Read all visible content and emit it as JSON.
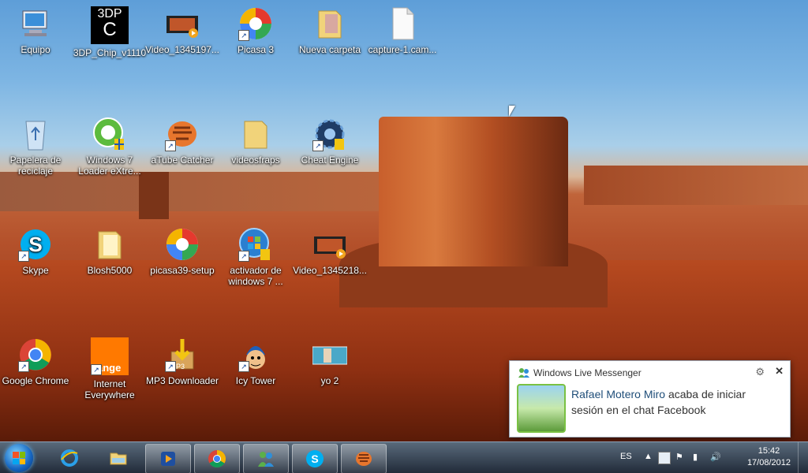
{
  "desktop_icons": [
    {
      "label": "Equipo"
    },
    {
      "label": "3DP_Chip_v1110",
      "logo": "3DP"
    },
    {
      "label": "Video_1345197..."
    },
    {
      "label": "Picasa 3"
    },
    {
      "label": "Nueva carpeta"
    },
    {
      "label": "capture-1.cam..."
    },
    {
      "label": "Papelera de reciclaje"
    },
    {
      "label": "Windows 7 Loader eXtre..."
    },
    {
      "label": "aTube Catcher"
    },
    {
      "label": "videosfraps"
    },
    {
      "label": "Cheat Engine"
    },
    {
      "label": "Skype"
    },
    {
      "label": "Blosh5000"
    },
    {
      "label": "picasa39-setup"
    },
    {
      "label": "activador de windows 7 ..."
    },
    {
      "label": "Video_1345218..."
    },
    {
      "label": "Google Chrome"
    },
    {
      "label": "Internet Everywhere",
      "logo": "ange"
    },
    {
      "label": "MP3 Downloader",
      "logo": "P3"
    },
    {
      "label": "Icy Tower"
    },
    {
      "label": "yo 2"
    }
  ],
  "taskbar": {
    "language": "ES",
    "time": "15:42",
    "date": "17/08/2012"
  },
  "notification": {
    "app": "Windows Live Messenger",
    "sender": "Rafael Motero Miro",
    "message": "acaba de iniciar sesión en el chat Facebook"
  }
}
